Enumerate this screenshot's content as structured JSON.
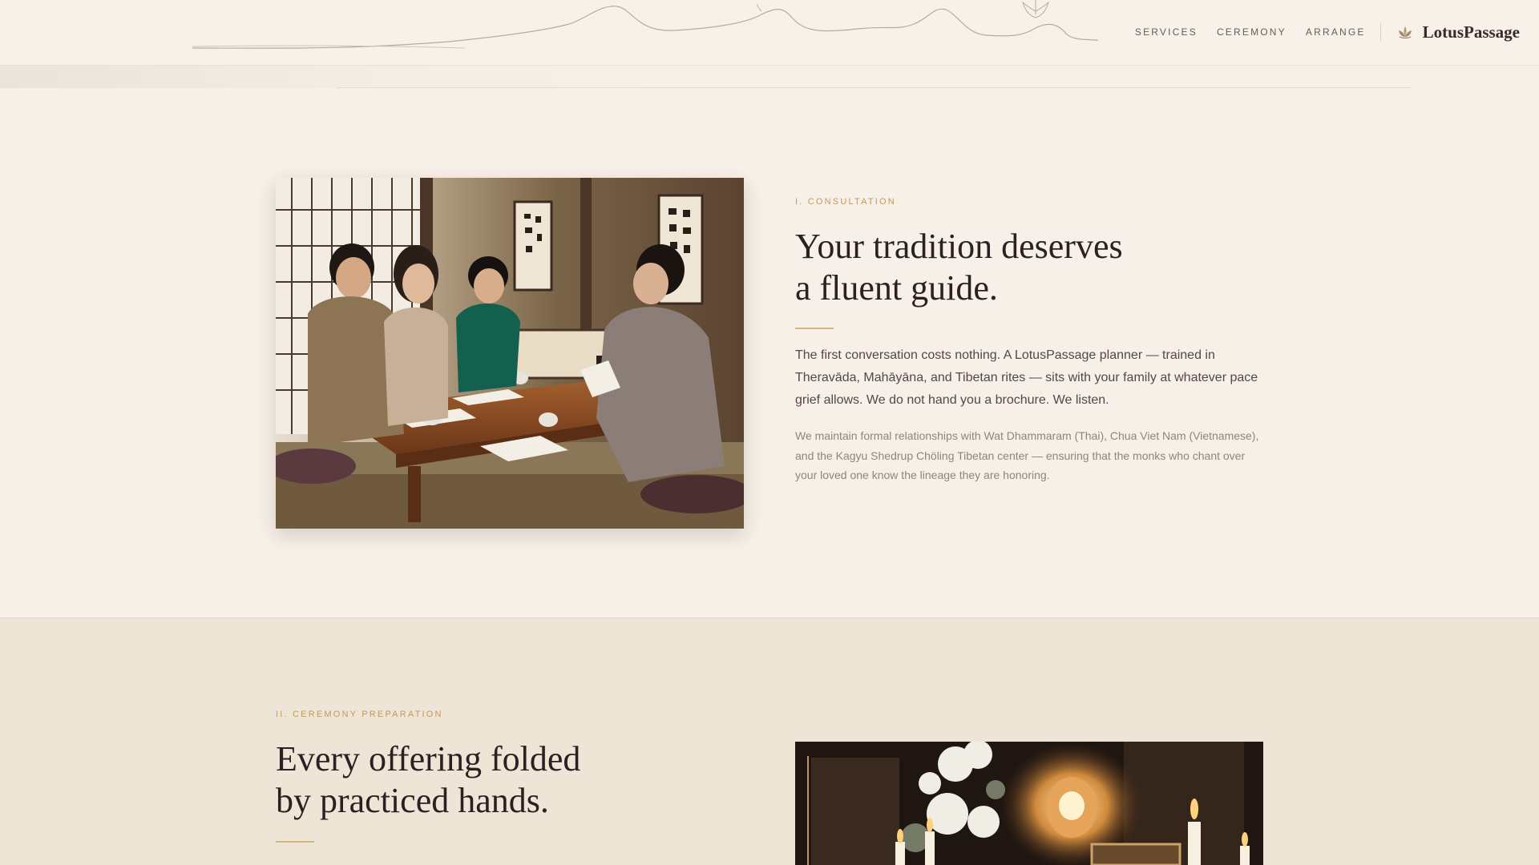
{
  "header": {
    "nav": [
      "SERVICES",
      "CEREMONY",
      "ARRANGE"
    ],
    "brand": "LotusPassage",
    "brand_icon": "lotus-icon"
  },
  "consultation": {
    "eyebrow": "I. CONSULTATION",
    "title_line1": "Your tradition deserves",
    "title_line2": "a fluent guide.",
    "lead": "The first conversation costs nothing. A LotusPassage planner — trained in Theravāda, Mahāyāna, and Tibetan rites — sits with your family at whatever pace grief allows. We do not hand you a brochure. We listen.",
    "detail": "We maintain formal relationships with Wat Dhammaram (Thai), Chua Viet Nam (Vietnamese), and the Kagyu Shedrup Chöling Tibetan center — ensuring that the monks who chant over your loved one know the lineage they are honoring."
  },
  "preparation": {
    "eyebrow": "II. CEREMONY PREPARATION",
    "title_line1": "Every offering folded",
    "title_line2": "by practiced hands."
  },
  "colors": {
    "background": "#f6f0e8",
    "section_alt": "#efe5d7",
    "accent_gold": "#bf9a5a",
    "heading": "#2e1f22"
  }
}
